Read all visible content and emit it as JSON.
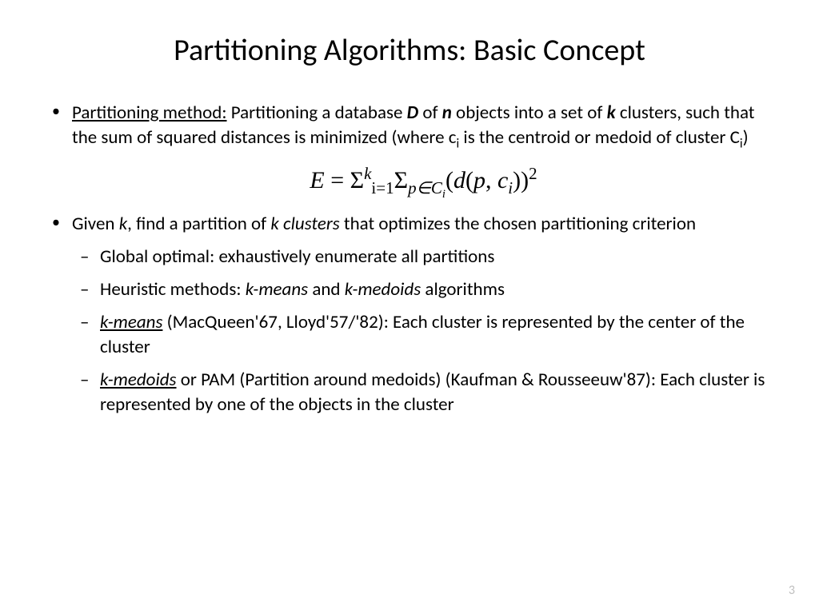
{
  "title": "Partitioning Algorithms: Basic Concept",
  "bullets": {
    "b1": {
      "lead": "Partitioning method:",
      "t1": " Partitioning a database ",
      "D": "D",
      "t2": " of ",
      "n": "n",
      "t3": " objects into a set of ",
      "k": "k",
      "t4": " clusters, such that the sum of squared distances is minimized (where c",
      "sub1": "i",
      "t5": " is the centroid or medoid of cluster C",
      "sub2": "i",
      "t6": ")"
    },
    "formula": {
      "E": "E",
      "eq": " = ",
      "sig1": "Σ",
      "sup1": "k",
      "sub1": "i=1",
      "sig2": "Σ",
      "sub2": "p∈C",
      "sub2i": "i",
      "open": "(",
      "d": "d",
      "open2": "(",
      "p": "p",
      "comma": ", ",
      "c": "c",
      "ci": "i",
      "close2": ")",
      "close": ")",
      "sq": "2"
    },
    "b2": {
      "t1": "Given ",
      "k": "k",
      "t2": ", find a partition of ",
      "kc": "k clusters",
      "t3": " that optimizes the chosen partitioning criterion"
    },
    "s1": "Global optimal: exhaustively enumerate all partitions",
    "s2": {
      "t1": "Heuristic methods: ",
      "km": "k-means",
      "t2": " and ",
      "kmed": "k-medoids",
      "t3": " algorithms"
    },
    "s3": {
      "km": "k-means",
      "t1": " (MacQueen'67, Lloyd'57/'82): Each cluster is represented by the center of the cluster"
    },
    "s4": {
      "kmed": "k-medoids",
      "t1": " or PAM (Partition around medoids) (Kaufman & Rousseeuw'87): Each cluster is represented by one of the objects in the cluster"
    }
  },
  "page": "3"
}
